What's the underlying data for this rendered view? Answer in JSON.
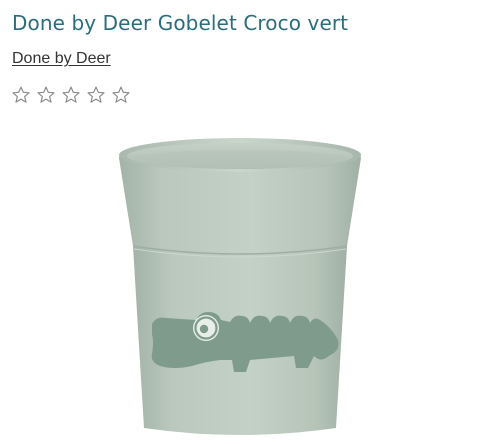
{
  "product": {
    "title": "Done by Deer Gobelet Croco vert",
    "brand": "Done by Deer"
  },
  "rating": {
    "value": 0,
    "max": 5,
    "star_icon": "star-outline-icon"
  },
  "colors": {
    "title": "#2b6d7a",
    "cup": "#b9c8bc",
    "crocodile": "#7f9b8b"
  }
}
